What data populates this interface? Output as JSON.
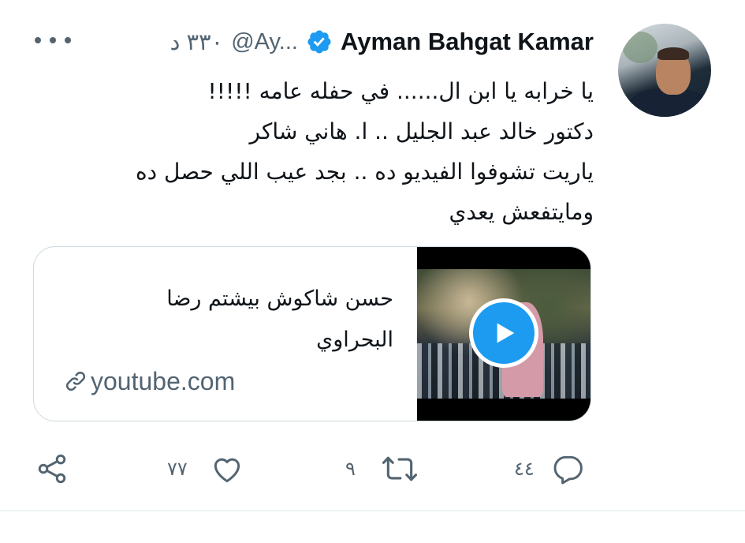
{
  "author": {
    "name": "Ayman Bahgat Kamar",
    "handle": "@Ay...",
    "time": "٣٣٠ د",
    "verified": true
  },
  "tweet": {
    "lines": [
      "يا خرابه يا ابن ال...... في حفله عامه !!!!!",
      "دكتور خالد عبد الجليل .. ا. هاني شاكر",
      "ياريت تشوفوا الفيديو ده .. بجد عيب اللي حصل ده",
      "ومايتفعش يعدي"
    ]
  },
  "card": {
    "title_line1": "حسن شاكوش بيشتم رضا",
    "title_line2": "البحراوي",
    "domain": "youtube.com"
  },
  "actions": {
    "replies": "٤٤",
    "retweets": "٩",
    "likes": "٧٧"
  },
  "colors": {
    "accent": "#1d9bf0",
    "secondary_text": "#536471",
    "border": "#cfd9de"
  },
  "icons": [
    "more-icon",
    "verified-badge-icon",
    "link-icon",
    "play-icon",
    "reply-icon",
    "retweet-icon",
    "like-icon",
    "share-icon"
  ]
}
